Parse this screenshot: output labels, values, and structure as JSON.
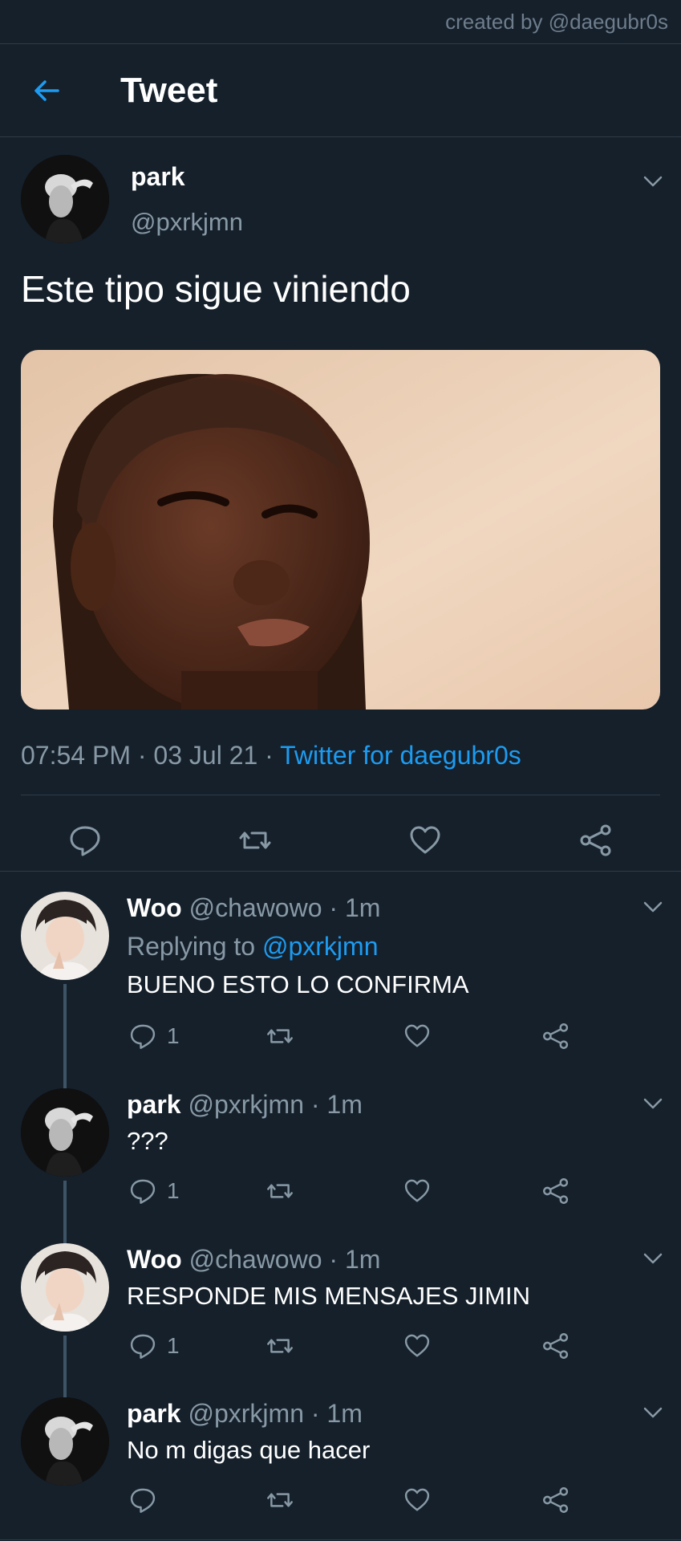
{
  "credit": "created by @daegubr0s",
  "header": {
    "title": "Tweet"
  },
  "tweet": {
    "name": "park",
    "handle": "@pxrkjmn",
    "text": "Este tipo sigue viniendo",
    "time": "07:54 PM",
    "date": "03 Jul 21",
    "source": "Twitter for daegubr0s"
  },
  "replies": [
    {
      "name": "Woo",
      "handle": "@chawowo",
      "time": "1m",
      "replying_prefix": "Replying to ",
      "replying_to": "@pxrkjmn",
      "text": "BUENO ESTO LO CONFIRMA",
      "reply_count": "1"
    },
    {
      "name": "park",
      "handle": "@pxrkjmn",
      "time": "1m",
      "text": "???",
      "reply_count": "1"
    },
    {
      "name": "Woo",
      "handle": "@chawowo",
      "time": "1m",
      "text": "RESPONDE MIS MENSAJES JIMIN",
      "reply_count": "1"
    },
    {
      "name": "park",
      "handle": "@pxrkjmn",
      "time": "1m",
      "text": "No m digas que hacer"
    }
  ],
  "dot_separator": "·",
  "colors": {
    "background": "#15202b",
    "accent": "#1d9bf0",
    "muted": "#8899a6",
    "divider": "#2f3b47"
  },
  "icons": [
    "back-arrow-icon",
    "chevron-down-icon",
    "reply-icon",
    "retweet-icon",
    "like-icon",
    "share-icon"
  ]
}
